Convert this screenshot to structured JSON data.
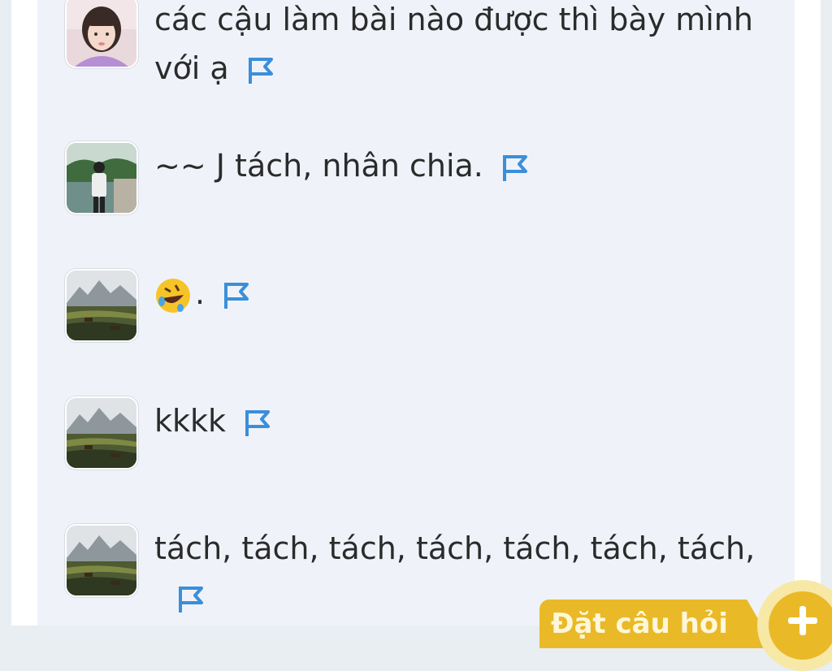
{
  "comments": [
    {
      "text": "các cậu làm bài nào được thì bày mình với ạ",
      "avatar": "girl-avatar-icon"
    },
    {
      "text": "~~ J tách, nhân chia.",
      "avatar": "lakeside-person-avatar-icon"
    },
    {
      "text": ".",
      "emoji": "rolling-laughing-emoji",
      "avatar": "mountain-landscape-avatar-icon"
    },
    {
      "text": "kkkk",
      "avatar": "mountain-landscape-avatar-icon"
    },
    {
      "text": "tách, tách, tách, tách, tách, tách, tách,",
      "avatar": "mountain-landscape-avatar-icon"
    }
  ],
  "actions": {
    "ask_question_label": "Đặt câu hỏi"
  },
  "colors": {
    "flag": "#3b8fd9",
    "accent": "#e9b928",
    "panel": "#eff3f9"
  }
}
